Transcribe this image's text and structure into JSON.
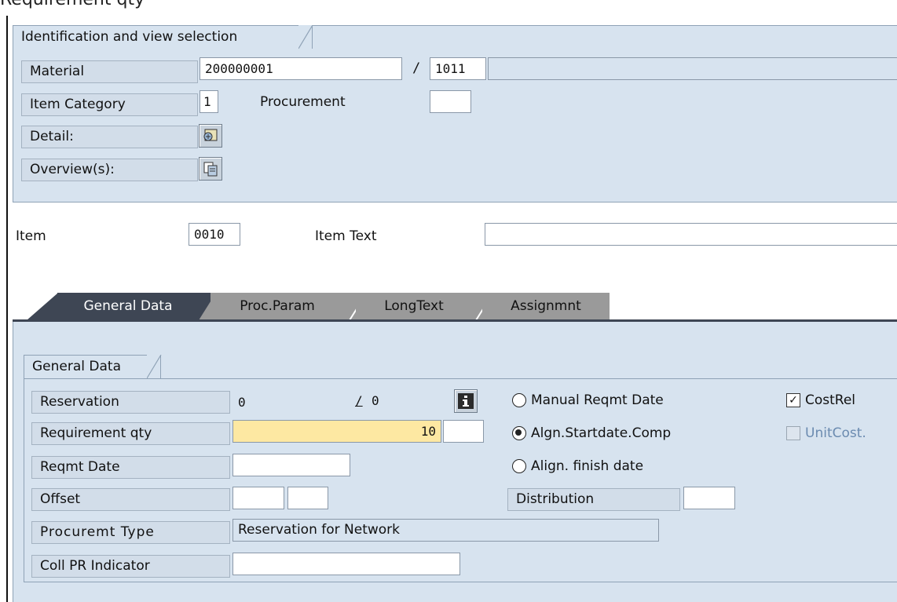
{
  "window_title": "Requirement qty",
  "identification": {
    "section_title": "Identification and view selection",
    "material_label": "Material",
    "material_value": "200000001",
    "separator": "/",
    "plant_value": "1011",
    "material_desc": "",
    "item_category_label": "Item Category",
    "item_category_value": "1",
    "procurement_label": "Procurement",
    "procurement_value": "",
    "detail_label": "Detail:",
    "detail_icon": "detail-view-icon",
    "overview_label": "Overview(s):",
    "overview_icon": "overview-icon"
  },
  "item": {
    "item_label": "Item",
    "item_value": "0010",
    "item_text_label": "Item Text",
    "item_text_value": ""
  },
  "tabs": [
    {
      "label": "General Data",
      "active": true
    },
    {
      "label": "Proc.Param",
      "active": false
    },
    {
      "label": "LongText",
      "active": false
    },
    {
      "label": "Assignmnt",
      "active": false
    }
  ],
  "general": {
    "section_title": "General Data",
    "reservation_label": "Reservation",
    "reservation_value": "0",
    "reservation_sep": "/",
    "reservation_item": "0",
    "info_icon": "info-icon",
    "requirement_qty_label": "Requirement qty",
    "requirement_qty_value": "10",
    "unit_value": "",
    "reqmt_date_label": "Reqmt Date",
    "reqmt_date_value": "",
    "offset_label": "Offset",
    "offset_value": "",
    "offset_unit": "",
    "procurement_type_label": "Procuremt Type",
    "procurement_type_value": "Reservation for Network",
    "coll_pr_label": "Coll PR Indicator",
    "coll_pr_value": "",
    "radio_manual": "Manual Reqmt Date",
    "radio_align_start": "Algn.Startdate.Comp",
    "radio_align_finish": "Align. finish date",
    "radio_selected": "Algn.Startdate.Comp",
    "distribution_label": "Distribution",
    "distribution_value": "",
    "costrel_label": "CostRel",
    "costrel_checked": true,
    "unitcost_label": "UnitCost.",
    "unitcost_checked": false
  }
}
